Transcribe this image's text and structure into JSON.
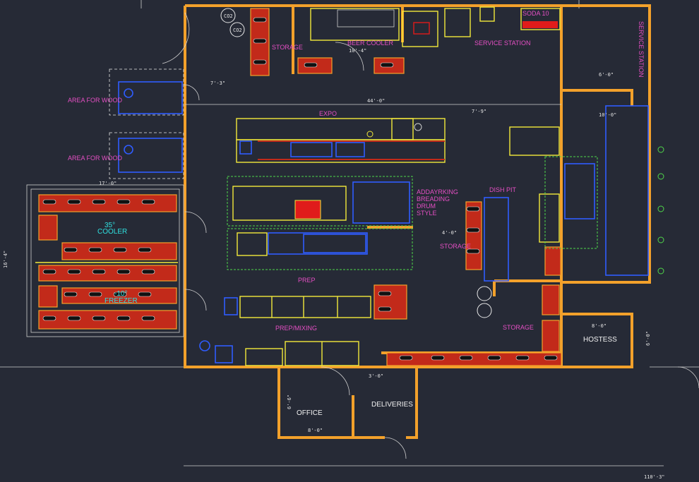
{
  "labels": {
    "storage_top": "STORAGE",
    "beer_cooler": "BEER COOLER",
    "service_station": "SERVICE STATION",
    "service_station_v": "SERVICE STATION",
    "soda": "SODA 10",
    "area_wood_1": "AREA FOR WOOD",
    "area_wood_2": "AREA FOR WOOD",
    "expo": "EXPO",
    "breading": "ADDAYRKING\nBREADING\nDRUM\nSTYLE",
    "dish_pit": "DISH PIT",
    "storage_mid": "STORAGE",
    "storage_low": "STORAGE",
    "cooler_temp": "35°",
    "cooler": "COOLER",
    "freezer_temp": "-10°",
    "freezer": "FREEZER",
    "prep": "PREP",
    "prep_mixing": "PREP/MIXING",
    "hostess": "HOSTESS",
    "office": "OFFICE",
    "deliveries": "DELIVERIES",
    "co2_a": "CO2",
    "co2_b": "CO2"
  },
  "dimensions": {
    "d1": "44'-0\"",
    "d2": "7'-3\"",
    "d3": "7'-9\"",
    "d4": "6'-0\"",
    "d5": "10'-0\"",
    "d6": "17'-0\"",
    "d7": "8'-0\"",
    "d8": "3'-0\"",
    "d9": "8'-0\"",
    "d10": "110'-3\"",
    "d11": "4'-0\"",
    "d12": "10'-4\"",
    "d13": "16'-4\"",
    "d14": "6'-0\"",
    "d15": "6'-6\""
  },
  "colors": {
    "background": "#262a36",
    "wall": "#f3a12b",
    "equipment": "#f3e93b",
    "equipment_blue": "#2f5cff",
    "tags": "#e54fc4",
    "shelving": "#c22a1a",
    "green_zone": "#4fd84a"
  }
}
